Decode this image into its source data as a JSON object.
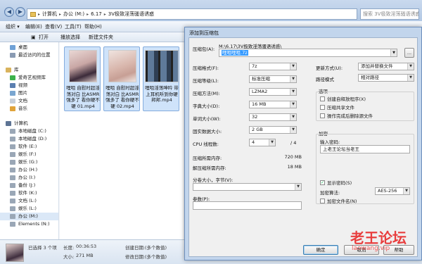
{
  "explorer": {
    "address": [
      "计算机",
      "办公 (M:)",
      "6.17",
      "3V极致淫荡骚语诱惑"
    ],
    "search_placeholder": "搜索 3V极致淫荡骚语诱惑",
    "menu": [
      "组织 ▾",
      "编辑(E)",
      "查看(V)",
      "工具(T)",
      "帮助(H)"
    ],
    "toolbar": [
      "打开",
      "播放选择",
      "新建文件夹"
    ],
    "sidebar": {
      "favorites": [
        "桌面",
        "最近访问的位置"
      ],
      "libraries_label": "库",
      "libraries": [
        "爱奇艺视频库",
        "视频",
        "图片",
        "文档",
        "音乐"
      ],
      "computer_label": "计算机",
      "drives": [
        "本地磁盘 (C:)",
        "本地磁盘 (D:)",
        "软件 (E:)",
        "娱乐 (F:)",
        "娱乐 (G:)",
        "办公 (H:)",
        "办公 (I:)",
        "备份 (J:)",
        "软件 (K:)",
        "文档 (L:)",
        "娱乐 (L:)",
        "办公 (M:)",
        "Elements (N:)"
      ],
      "selected_drive": "办公 (M:)"
    },
    "files": [
      {
        "name": "哩咀 自慰时超淫荡对白 比ASMR强多了 看你硬不硬 01.mp4"
      },
      {
        "name": "哩咀 自慰时超淫荡对白 比ASMR强多了 看你硬不硬 02.mp4"
      },
      {
        "name": "哩咀淫荡呻吟 带上耳机听到你硬邦邦.mp4"
      }
    ],
    "status": {
      "selected": "已选择 3 个项",
      "length_label": "长度:",
      "length": "00:36:53",
      "size_label": "大小:",
      "size": "271 MB",
      "created_label": "创建日期:",
      "created": "(多个数值)",
      "modified_label": "修改日期:",
      "modified": "(多个数值)"
    }
  },
  "dialog": {
    "title": "添加到压缩包",
    "archive_label": "压缩包(A):",
    "archive_path": "M:\\6.17\\3V极致淫荡骚语诱惑\\",
    "archive_name": "哩咀哩咀.7z",
    "browse": "...",
    "format_label": "压缩格式(F):",
    "format": "7z",
    "level_label": "压缩等级(L):",
    "level": "标准压缩",
    "method_label": "压缩方法(M):",
    "method": "LZMA2",
    "dict_label": "字典大小(D):",
    "dict": "16 MB",
    "word_label": "单词大小(W):",
    "word": "32",
    "solid_label": "固实数据大小:",
    "solid": "2 GB",
    "cpu_label": "CPU 线程数:",
    "cpu": "4",
    "cpu_max": "/ 4",
    "mem_comp_label": "压缩所需内存:",
    "mem_comp": "720 MB",
    "mem_decomp_label": "解压缩所需内存:",
    "mem_decomp": "18 MB",
    "split_label": "分卷大小，字节(V):",
    "params_label": "参数(P):",
    "update_label": "更新方式(U):",
    "update": "添加并替换文件",
    "path_label": "路径模式",
    "path": "相对路径",
    "options_label": "选项",
    "options": [
      {
        "label": "创建自释放程序(X)",
        "checked": false
      },
      {
        "label": "压缩共享文件",
        "checked": false
      },
      {
        "label": "操作完成后删除源文件",
        "checked": false
      }
    ],
    "encrypt_label": "加密",
    "password_label": "输入密码:",
    "password": "上老王论坛当老王",
    "show_password": "显示密码(S)",
    "show_password_checked": true,
    "enc_method_label": "加密算法:",
    "enc_method": "AES-256",
    "encrypt_names": "加密文件名(N)",
    "ok": "确定",
    "cancel": "取消",
    "help": "帮助"
  },
  "watermark": {
    "main": "老王论坛",
    "sub": "laowang.vip"
  }
}
